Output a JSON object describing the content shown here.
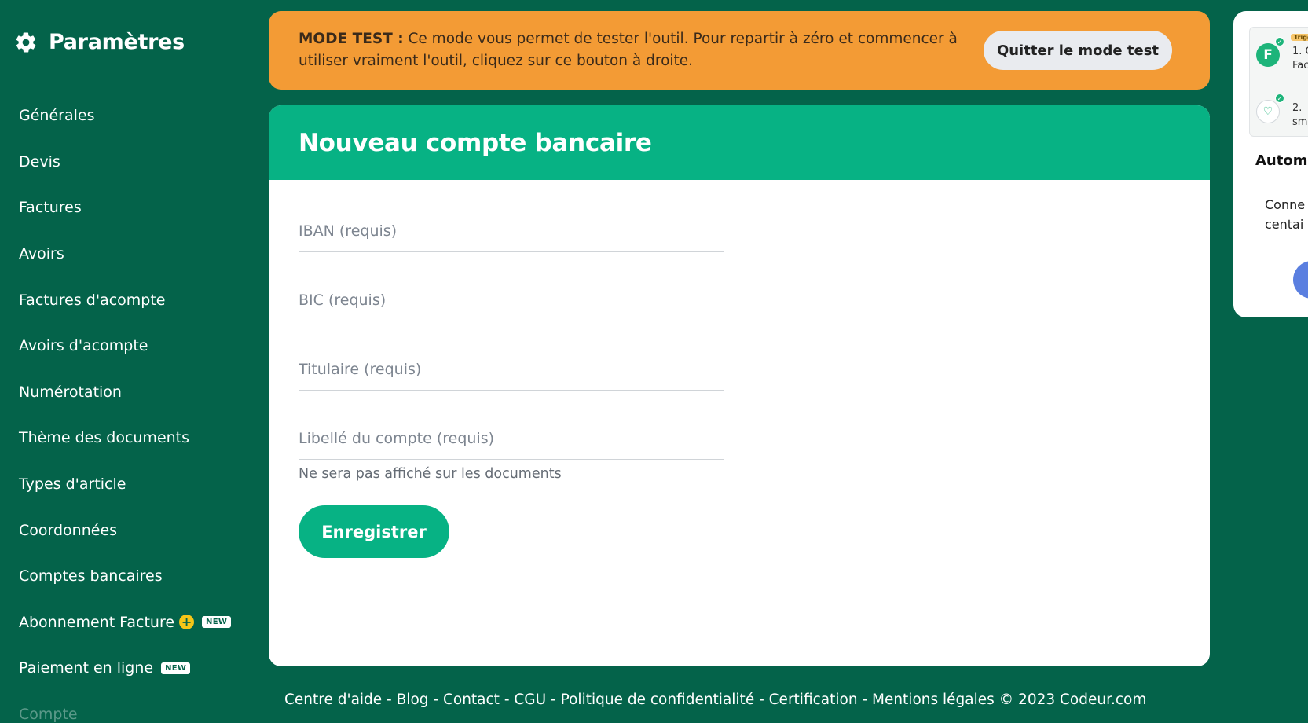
{
  "sidebar": {
    "title": "Paramètres",
    "items": [
      {
        "label": "Générales"
      },
      {
        "label": "Devis"
      },
      {
        "label": "Factures"
      },
      {
        "label": "Avoirs"
      },
      {
        "label": "Factures d'acompte"
      },
      {
        "label": "Avoirs d'acompte"
      },
      {
        "label": "Numérotation"
      },
      {
        "label": "Thème des documents"
      },
      {
        "label": "Types d'article"
      },
      {
        "label": "Coordonnées"
      },
      {
        "label": "Comptes bancaires"
      },
      {
        "label": "Abonnement Facture",
        "badge_plus": "+",
        "badge_new": "NEW"
      },
      {
        "label": "Paiement en ligne",
        "badge_new": "NEW"
      },
      {
        "label": "Compte"
      }
    ]
  },
  "banner": {
    "bold_label": "MODE TEST :",
    "text": " Ce mode vous permet de tester l'outil. Pour repartir à zéro et commencer à utiliser vraiment l'outil, cliquez sur ce bouton à droite.",
    "button_label": "Quitter le mode test",
    "color": "#f39b35"
  },
  "form": {
    "title": "Nouveau compte bancaire",
    "iban_placeholder": "IBAN (requis)",
    "bic_placeholder": "BIC (requis)",
    "holder_placeholder": "Titulaire (requis)",
    "label_placeholder": "Libellé du compte (requis)",
    "label_hint": "Ne sera pas affiché sur les documents",
    "save_label": "Enregistrer",
    "accent_color": "#07b284"
  },
  "footer": {
    "links": [
      "Centre d'aide",
      "Blog",
      "Contact",
      "CGU",
      "Politique de confidentialité",
      "Certification",
      "Mentions légales"
    ],
    "copyright": "© 2023 Codeur.com",
    "separator": " - "
  },
  "side_panel": {
    "trigger_tag": "Trigger",
    "step1_line1": "1. C",
    "step1_line2": "Fac",
    "step2_line1": "2.",
    "step2_line2": "sm",
    "app_letter": "F",
    "title": "Automa",
    "desc_line1": "Conne",
    "desc_line2": "centai"
  },
  "colors": {
    "background": "#04634a",
    "header": "#07b284"
  }
}
